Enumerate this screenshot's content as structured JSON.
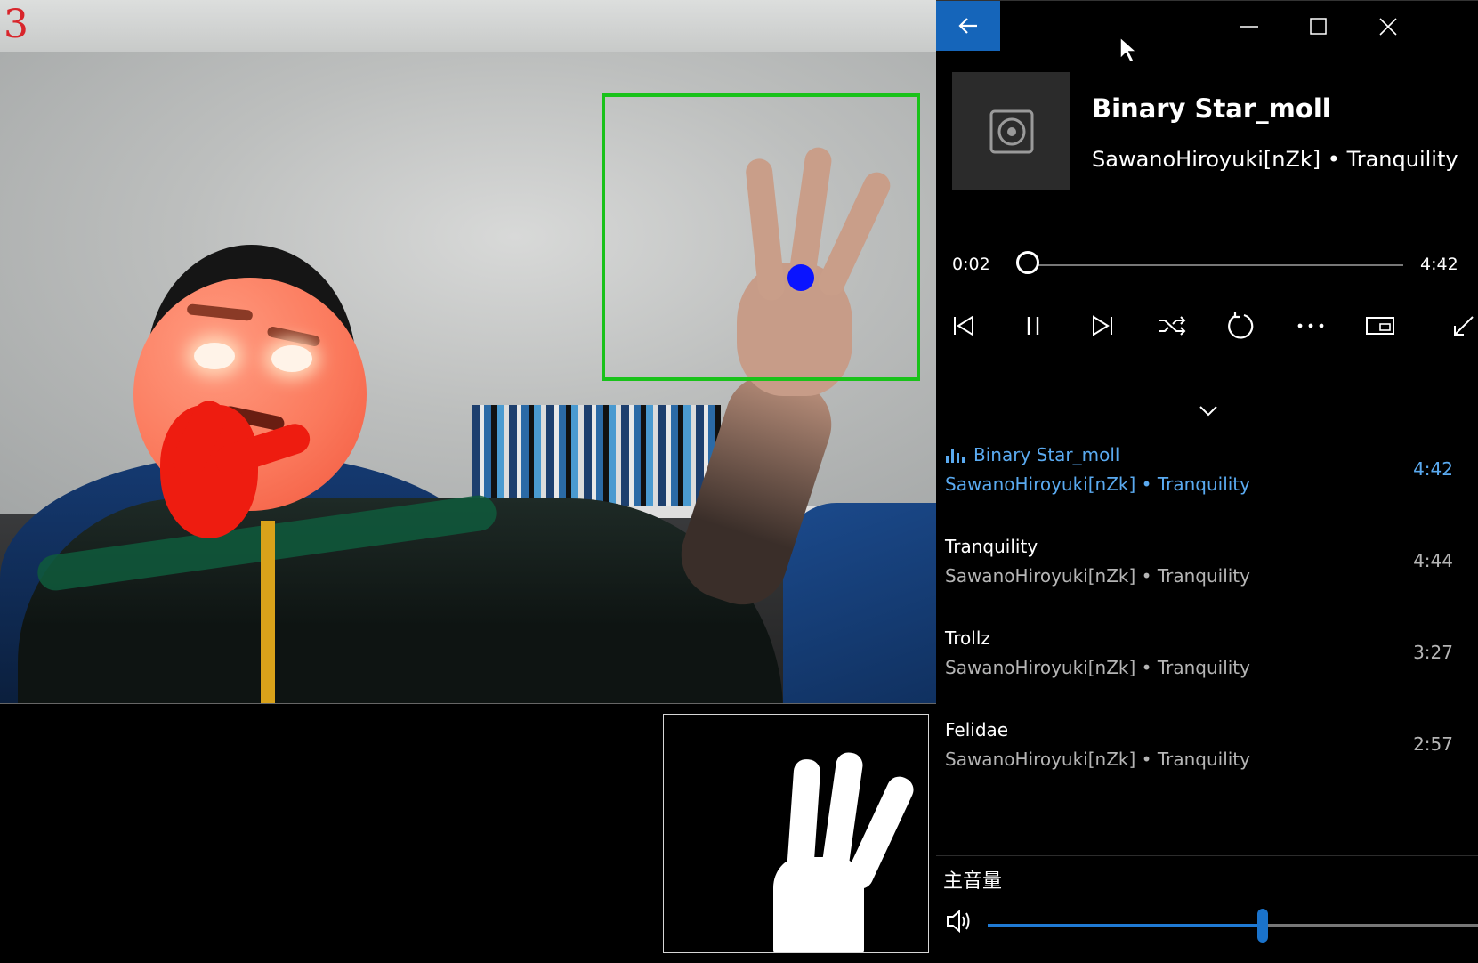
{
  "camera": {
    "frame_count": "3"
  },
  "player": {
    "now_playing": {
      "title": "Binary Star_moll",
      "subtitle": "SawanoHiroyuki[nZk] • Tranquility"
    },
    "progress": {
      "current": "0:02",
      "total": "4:42",
      "fraction": 0.007
    },
    "controls": [
      "previous-icon",
      "pause-icon",
      "next-icon",
      "shuffle-icon",
      "repeat-icon",
      "more-icon",
      "mini-view-icon",
      "full-screen-icon"
    ],
    "queue": [
      {
        "title": "Binary Star_moll",
        "artist": "SawanoHiroyuki[nZk]",
        "album": "Tranquility",
        "duration": "4:42",
        "active": true
      },
      {
        "title": "Tranquility",
        "artist": "SawanoHiroyuki[nZk]",
        "album": "Tranquility",
        "duration": "4:44",
        "active": false
      },
      {
        "title": "Trollz",
        "artist": "SawanoHiroyuki[nZk]",
        "album": "Tranquility",
        "duration": "3:27",
        "active": false
      },
      {
        "title": "Felidae",
        "artist": "SawanoHiroyuki[nZk]",
        "album": "Tranquility",
        "duration": "2:57",
        "active": false
      }
    ],
    "separator": " • ",
    "volume": {
      "label": "主音量",
      "level": 0.56
    },
    "colors": {
      "accent": "#1565ba",
      "active_text": "#5aaaf0",
      "detect_box": "#19c21a",
      "detect_dot": "#0a14ff",
      "frame_count": "#d8252b"
    }
  }
}
